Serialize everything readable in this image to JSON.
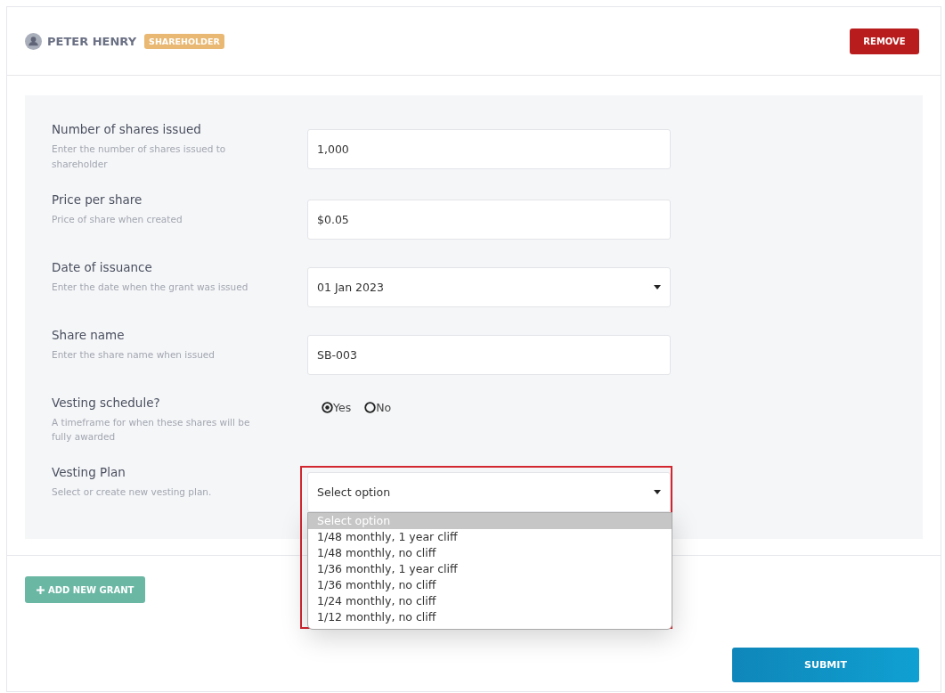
{
  "header": {
    "name": "PETER HENRY",
    "badge": "SHAREHOLDER",
    "remove_button": "REMOVE"
  },
  "fields": [
    {
      "kind": "text",
      "label": "Number of shares issued",
      "description": "Enter the number of shares issued to shareholder",
      "value": "1,000"
    },
    {
      "kind": "text",
      "label": "Price per share",
      "description": "Price of share when created",
      "value": "$0.05"
    },
    {
      "kind": "select",
      "label": "Date of issuance",
      "description": "Enter the date when the grant was issued",
      "value": "01 Jan 2023"
    },
    {
      "kind": "text",
      "label": "Share name",
      "description": "Enter the share name when issued",
      "value": "SB-003"
    },
    {
      "kind": "radio",
      "label": "Vesting schedule?",
      "description": "A timeframe for when these shares will be fully awarded",
      "options": [
        {
          "label": "Yes",
          "selected": true
        },
        {
          "label": "No",
          "selected": false
        }
      ]
    },
    {
      "kind": "select",
      "label": "Vesting Plan",
      "description": "Select or create new vesting plan.",
      "value": "Select option",
      "expanded": true,
      "options": [
        {
          "label": "Select option",
          "selected": true
        },
        {
          "label": "1/48 monthly, 1 year cliff",
          "selected": false
        },
        {
          "label": "1/48 monthly, no cliff",
          "selected": false
        },
        {
          "label": "1/36 monthly, 1 year cliff",
          "selected": false
        },
        {
          "label": "1/36 monthly, no cliff",
          "selected": false
        },
        {
          "label": "1/24 monthly, no cliff",
          "selected": false
        },
        {
          "label": "1/12 monthly, no cliff",
          "selected": false
        }
      ]
    }
  ],
  "add_grant_button": "ADD NEW GRANT",
  "submit_button": "SUBMIT"
}
